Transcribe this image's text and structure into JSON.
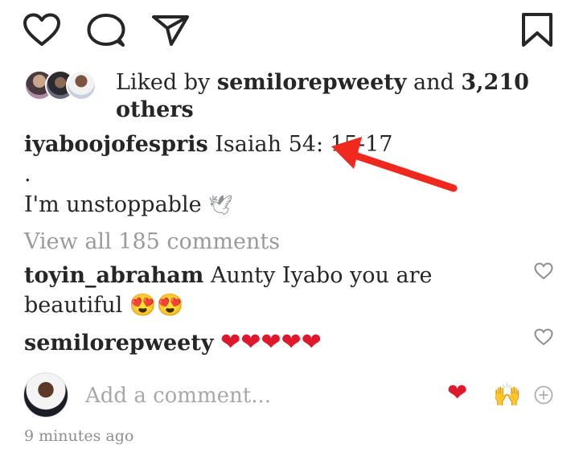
{
  "actions": {
    "like_icon": "heart-outline",
    "comment_icon": "speech-bubble",
    "share_icon": "paper-plane",
    "save_icon": "bookmark"
  },
  "likes": {
    "prefix": "Liked by ",
    "user": "semilorepweety",
    "middle": " and ",
    "count": "3,210",
    "suffix": "others"
  },
  "caption": {
    "user": "iyaboojofespris",
    "text": "Isaiah 54: 15-17",
    "dot": ".",
    "line2": "I'm unstoppable",
    "line2_emoji": "🕊"
  },
  "view_all_comments": "View all 185 comments",
  "comments": [
    {
      "user": "toyin_abraham",
      "text": "Aunty  Iyabo you are",
      "text2": "beautiful",
      "emoji": "😍😍"
    },
    {
      "user": "semilorepweety",
      "hearts": "❤❤❤❤❤"
    }
  ],
  "add_comment": {
    "placeholder": "Add a comment...",
    "quick_heart": "❤",
    "quick_hands": "🙌",
    "plus_icon": "plus-circle"
  },
  "timestamp": "9 minutes ago",
  "colors": {
    "text": "#262626",
    "muted": "#9a9a9a",
    "heart": "#e0182c",
    "arrow": "#f0281e"
  }
}
